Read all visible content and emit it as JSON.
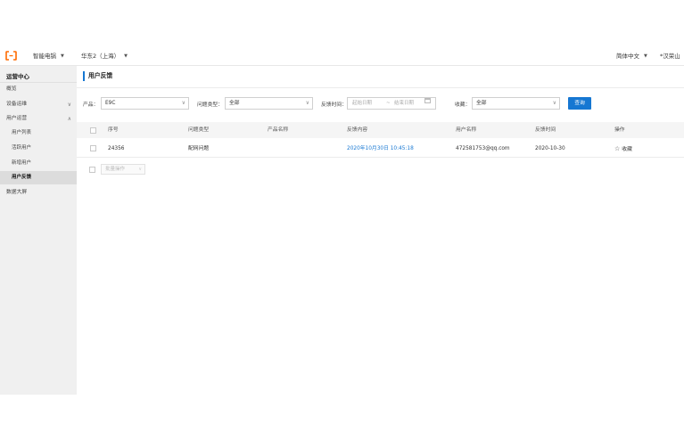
{
  "topbar": {
    "product_name": "智能电锅",
    "region": "华东2（上海）",
    "language": "简体中文",
    "user": "*汉荣山"
  },
  "sidebar": {
    "title": "运营中心",
    "items": [
      {
        "label": "概览"
      },
      {
        "label": "设备运维"
      },
      {
        "label": "用户运营"
      },
      {
        "label": "用户列表"
      },
      {
        "label": "活跃用户"
      },
      {
        "label": "新增用户"
      },
      {
        "label": "用户反馈"
      },
      {
        "label": "数据大屏"
      }
    ]
  },
  "page": {
    "title": "用户反馈"
  },
  "filters": {
    "product_label": "产品：",
    "product_value": "E9C",
    "issue_type_label": "问题类型：",
    "issue_type_value": "全部",
    "time_label": "反馈时间：",
    "start_placeholder": "起始日期",
    "range_sep": "~",
    "end_placeholder": "结束日期",
    "favorite_label": "收藏：",
    "favorite_value": "全部",
    "query_button": "查询"
  },
  "table": {
    "columns": [
      "序号",
      "问题类型",
      "产品名称",
      "反馈内容",
      "用户名称",
      "反馈时间",
      "操作"
    ],
    "rows": [
      {
        "id": "24356",
        "issue_type": "配网问题",
        "product_name": "",
        "content": "2020年10月30日 10:45:18",
        "user_name": "472581753@qq.com",
        "time": "2020-10-30",
        "action": "收藏"
      }
    ],
    "bulk_action": "批量操作"
  }
}
